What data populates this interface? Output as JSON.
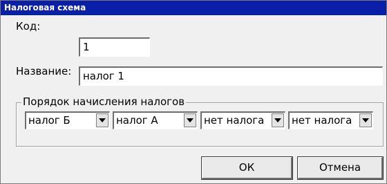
{
  "window": {
    "title": "Налоговая схема"
  },
  "form": {
    "code_label": "Код:",
    "code_value": "1",
    "name_label": "Название:",
    "name_value": "налог 1"
  },
  "order_group": {
    "legend": "Порядок начисления налогов",
    "combos": [
      {
        "value": "налог Б"
      },
      {
        "value": "налог А"
      },
      {
        "value": "нет налога"
      },
      {
        "value": "нет налога"
      }
    ]
  },
  "buttons": {
    "ok": "ОК",
    "cancel": "Отмена"
  }
}
